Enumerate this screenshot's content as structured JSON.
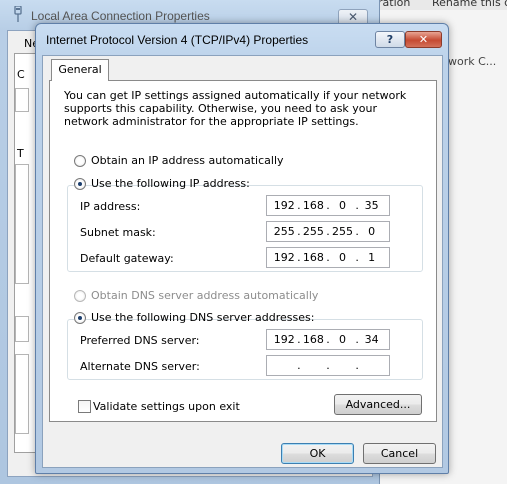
{
  "background": {
    "right_header": "ration",
    "right_header2": "Rename this c",
    "right_item": "work C...",
    "window": {
      "title": "Local Area Connection Properties",
      "close_label": "✕",
      "tab_fragment": "Ne",
      "fragment_1": "C",
      "fragment_2": "T"
    }
  },
  "dialog": {
    "title": "Internet Protocol Version 4 (TCP/IPv4) Properties",
    "help_label": "?",
    "close_label": "✕",
    "tab": "General",
    "intro": "You can get IP settings assigned automatically if your network supports this capability. Otherwise, you need to ask your network administrator for the appropriate IP settings.",
    "ip": {
      "auto_label": "Obtain an IP address automatically",
      "manual_label": "Use the following IP address:",
      "address_label": "IP address:",
      "address": [
        "192",
        "168",
        "0",
        "35"
      ],
      "mask_label": "Subnet mask:",
      "mask": [
        "255",
        "255",
        "255",
        "0"
      ],
      "gateway_label": "Default gateway:",
      "gateway": [
        "192",
        "168",
        "0",
        "1"
      ]
    },
    "dns": {
      "auto_label": "Obtain DNS server address automatically",
      "manual_label": "Use the following DNS server addresses:",
      "preferred_label": "Preferred DNS server:",
      "preferred": [
        "192",
        "168",
        "0",
        "34"
      ],
      "alternate_label": "Alternate DNS server:",
      "alternate": [
        "",
        "",
        "",
        ""
      ]
    },
    "validate_label": "Validate settings upon exit",
    "advanced_label": "Advanced...",
    "ok_label": "OK",
    "cancel_label": "Cancel"
  }
}
